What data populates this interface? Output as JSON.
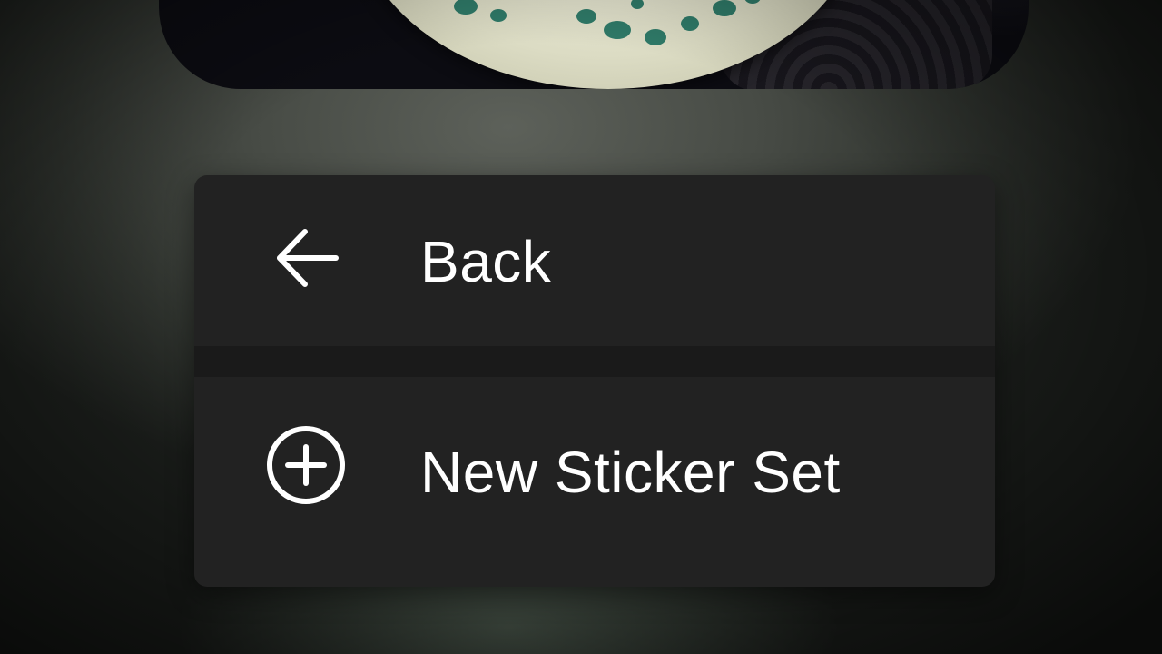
{
  "menu": {
    "items": [
      {
        "label": "Back",
        "icon": "arrow-left-icon"
      },
      {
        "label": "New Sticker Set",
        "icon": "plus-circle-icon"
      }
    ]
  },
  "colors": {
    "menu_background": "#222222",
    "separator": "#1a1a1a",
    "text": "#ffffff"
  }
}
